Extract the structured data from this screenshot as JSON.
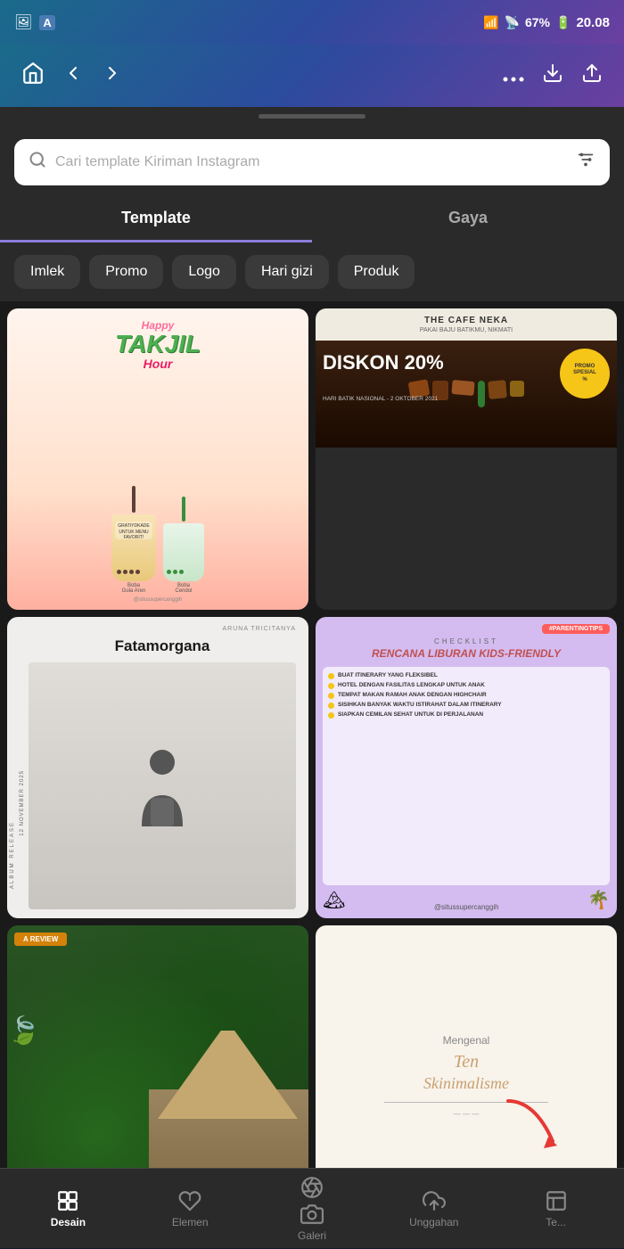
{
  "statusBar": {
    "signal": "67%",
    "time": "20.08",
    "wifiIcon": "📶",
    "batteryIcon": "🔋"
  },
  "navbar": {
    "homeIcon": "⌂",
    "backIcon": "←",
    "forwardIcon": "→",
    "moreIcon": "•••",
    "downloadIcon": "⬇",
    "shareIcon": "⬆"
  },
  "search": {
    "placeholder": "Cari template Kiriman Instagram",
    "filterIcon": "⚙"
  },
  "tabs": [
    {
      "id": "template",
      "label": "Template",
      "active": true
    },
    {
      "id": "gaya",
      "label": "Gaya",
      "active": false
    }
  ],
  "categories": [
    {
      "id": "imlek",
      "label": "Imlek"
    },
    {
      "id": "promo",
      "label": "Promo"
    },
    {
      "id": "logo",
      "label": "Logo"
    },
    {
      "id": "harigizi",
      "label": "Hari gizi"
    },
    {
      "id": "produk",
      "label": "Produk"
    }
  ],
  "templates": [
    {
      "id": "takjil",
      "title": "Happy Takjil Hour",
      "subtitle": "Boba Gula Aren / Boba Cendol",
      "footer": "@situssupercanggih"
    },
    {
      "id": "diskon",
      "shopName": "THE CAFE NEKA",
      "tagline": "PAKAI BAJU BATIKMU, NIKMATI",
      "title": "DISKON 20%",
      "subtitle": "HARI BATIK NASIONAL - 2 OKTOBER 2021",
      "badge": "PROMO SPESIAL %"
    },
    {
      "id": "fatamorgana",
      "author": "ARUNA TRICITANYA",
      "date": "12 NOVEMBER 2025",
      "albumTitle": "Fatamorgana",
      "releaseLabel": "ALBUM RELEASE"
    },
    {
      "id": "liburan",
      "tag": "#PARENTINGTIPS",
      "checklistLabel": "CHECKLIST",
      "title": "RENCANA LIBURAN KIDS-FRIENDLY",
      "items": [
        "BUAT ITINERARY YANG FLEKSIBEL",
        "HOTEL DENGAN FASILITAS LENGKAP UNTUK ANAK",
        "TEMPAT MAKAN RAMAH ANAK DENGAN HIGHCHAIR",
        "SISIHKAN BANYAK WAKTU ISTIRAHAT DALAM ITINERARY",
        "SIAPKAN CEMILAN SEHAT UNTUK DI PERJALANAN"
      ],
      "footer": "@situssupercanggih"
    },
    {
      "id": "review",
      "badge": "A REVIEW"
    },
    {
      "id": "mengenal",
      "label": "Mengenal",
      "title": "Ten Skinimalisme"
    }
  ],
  "bottomNav": [
    {
      "id": "desain",
      "label": "Desain",
      "icon": "desain",
      "active": true
    },
    {
      "id": "elemen",
      "label": "Elemen",
      "icon": "elemen",
      "active": false
    },
    {
      "id": "galeri",
      "label": "Galeri",
      "icon": "galeri",
      "active": false
    },
    {
      "id": "unggahan",
      "label": "Unggahan",
      "icon": "unggahan",
      "active": false
    },
    {
      "id": "te",
      "label": "Te...",
      "icon": "te",
      "active": false
    }
  ],
  "colors": {
    "accent": "#8b7dd8",
    "navBg": "#2a2a2a",
    "active": "#ffffff",
    "inactive": "#888888",
    "headerGradientStart": "#1a6b8a",
    "headerGradientMid": "#2d4a9e",
    "headerGradientEnd": "#6b3fa0"
  }
}
